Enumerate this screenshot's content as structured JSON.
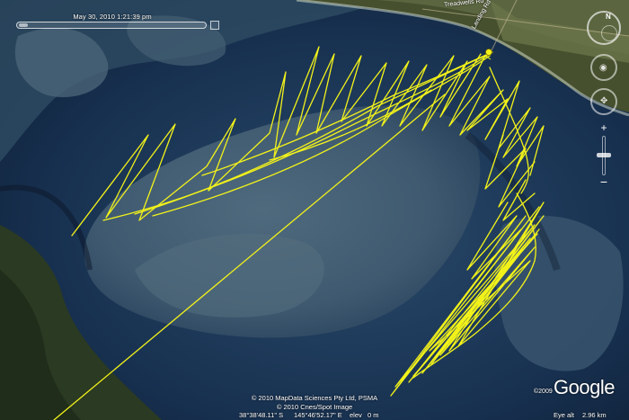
{
  "timestamp": "May 30, 2010   1:21:39 pm",
  "road_labels": [
    "Treadwells Rd",
    "Landing Rd"
  ],
  "attribution": [
    "© 2010 MapData Sciences Pty Ltd, PSMA",
    "© 2010 Cnes/Spot Image"
  ],
  "logo": {
    "text": "Google",
    "year": "©2009"
  },
  "status": {
    "latitude": "38°38'48.11\" S",
    "longitude": "145°46'52.17\" E",
    "elev_label": "elev",
    "elev_value": "0 m",
    "eye_alt_label": "Eye alt",
    "eye_alt_value": "2.96 km"
  },
  "nav": {
    "compass_letter": "N",
    "zoom_in": "+",
    "zoom_out": "−"
  },
  "colors": {
    "track": "#f2f21a",
    "water": "#12233d",
    "sandbank": "#3d5870",
    "land": "#2b3a22",
    "farmland": "#46502e"
  },
  "icons": [
    "compass-icon",
    "look-joystick-icon",
    "move-joystick-icon",
    "zoom-in-icon",
    "zoom-out-icon",
    "placemark-icon"
  ]
}
